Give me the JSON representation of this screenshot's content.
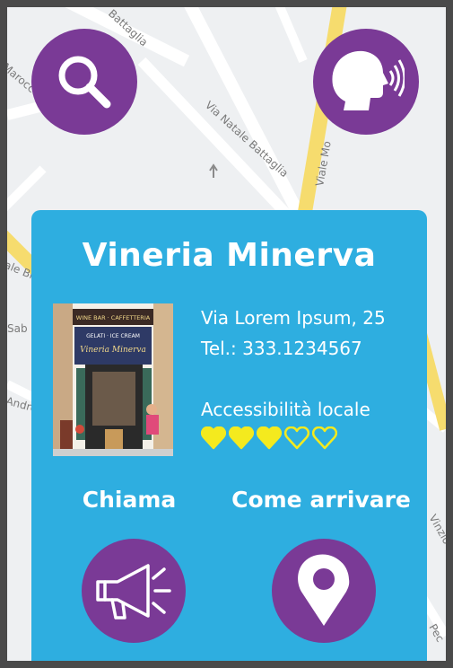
{
  "map": {
    "streets": [
      "Battaglia",
      "Via Natale Battaglia",
      "Viale Mo",
      "Marocco",
      "Vinzio",
      "Sab",
      "Andre",
      "Pec"
    ],
    "label_left": "ale Bi"
  },
  "toolbar": {
    "search_icon": "search-icon",
    "voice_icon": "voice-speaking-icon"
  },
  "place": {
    "name": "Vineria Minerva",
    "address": "Via Lorem Ipsum, 25",
    "phone": "Tel.: 333.1234567",
    "accessibility_label": "Accessibilità locale",
    "accessibility_rating": 3,
    "accessibility_max": 5,
    "photo_sign_top": "WINE BAR · CAFFETTERIA",
    "photo_sign_mid": "GELATI · ICE CREAM",
    "photo_sign_name": "Vineria Minerva"
  },
  "actions": {
    "call_label": "Chiama",
    "directions_label": "Come arrivare"
  },
  "colors": {
    "purple": "#7a3a96",
    "card_blue": "#2eaee0",
    "heart_yellow": "#f4ea1e",
    "road_yellow": "#f6dc6e"
  }
}
